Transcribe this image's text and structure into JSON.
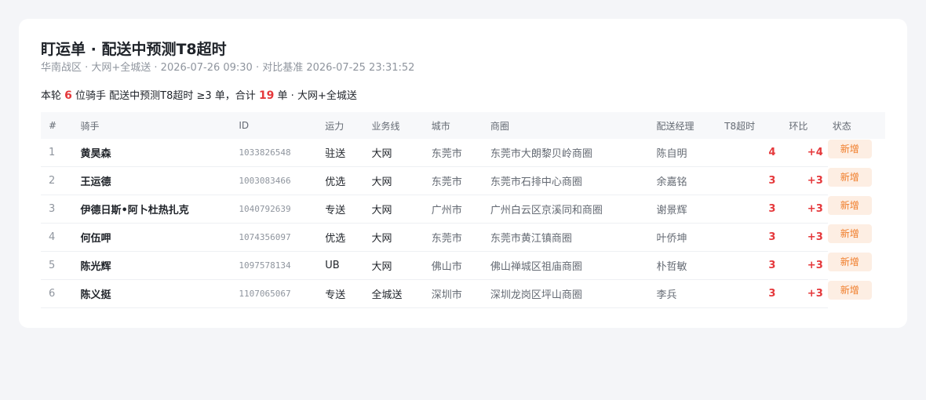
{
  "header": {
    "title": "盯运单 · 配送中预测T8超时",
    "subtitle": "华南战区 · 大网+全城送 · 2026-07-26 09:30 · 对比基准 2026-07-25 23:31:52"
  },
  "summary": {
    "prefix": "本轮 ",
    "riders": "6",
    "mid": " 位骑手 配送中预测T8超时 ≥3 单，合计 ",
    "orders": "19",
    "suffix": " 单 · 大网+全城送"
  },
  "table": {
    "headers": [
      "#",
      "骑手",
      "ID",
      "运力",
      "业务线",
      "城市",
      "商圈",
      "配送经理",
      "T8超时",
      "环比",
      "状态"
    ],
    "rows": [
      {
        "idx": "1",
        "name": "黄昊森",
        "id": "1033826548",
        "capacity": "驻送",
        "line": "大网",
        "city": "东莞市",
        "zone": "东莞市大朗黎贝岭商圈",
        "manager": "陈自明",
        "t8": "4",
        "diff": "+4",
        "status": "新增"
      },
      {
        "idx": "2",
        "name": "王运德",
        "id": "1003083466",
        "capacity": "优选",
        "line": "大网",
        "city": "东莞市",
        "zone": "东莞市石排中心商圈",
        "manager": "余嘉铭",
        "t8": "3",
        "diff": "+3",
        "status": "新增"
      },
      {
        "idx": "3",
        "name": "伊德日斯•阿卜杜热扎克",
        "id": "1040792639",
        "capacity": "专送",
        "line": "大网",
        "city": "广州市",
        "zone": "广州白云区京溪同和商圈",
        "manager": "谢景辉",
        "t8": "3",
        "diff": "+3",
        "status": "新增"
      },
      {
        "idx": "4",
        "name": "何伍呷",
        "id": "1074356097",
        "capacity": "优选",
        "line": "大网",
        "city": "东莞市",
        "zone": "东莞市黄江镇商圈",
        "manager": "叶侨坤",
        "t8": "3",
        "diff": "+3",
        "status": "新增"
      },
      {
        "idx": "5",
        "name": "陈光辉",
        "id": "1097578134",
        "capacity": "UB",
        "line": "大网",
        "city": "佛山市",
        "zone": "佛山禅城区祖庙商圈",
        "manager": "朴哲敏",
        "t8": "3",
        "diff": "+3",
        "status": "新增"
      },
      {
        "idx": "6",
        "name": "陈义挺",
        "id": "1107065067",
        "capacity": "专送",
        "line": "全城送",
        "city": "深圳市",
        "zone": "深圳龙岗区坪山商圈",
        "manager": "李兵",
        "t8": "3",
        "diff": "+3",
        "status": "新增"
      }
    ]
  },
  "colors": {
    "accent_red": "#e5383b",
    "badge_bg": "#fdeee3",
    "badge_text": "#f07c28"
  }
}
